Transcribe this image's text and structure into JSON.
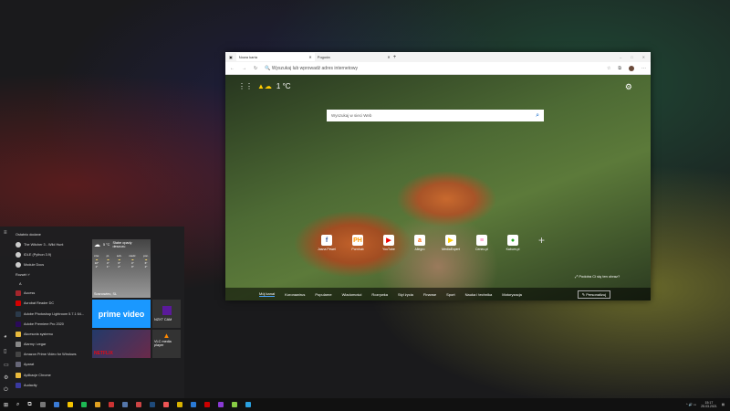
{
  "browser": {
    "tabs": [
      {
        "label": "Nowa karta",
        "active": true
      },
      {
        "label": "Pogoda",
        "active": false
      }
    ],
    "address_placeholder": "Wyszukaj lub wprowadź adres internetowy",
    "weather_temp": "1 °C",
    "search_placeholder": "Wyszukaj w sieci Web",
    "quick_links": [
      {
        "label": "Jasna Pewel",
        "icon": "f",
        "color": "#3b5998"
      },
      {
        "label": "Pornhub",
        "icon": "PH",
        "color": "#f90"
      },
      {
        "label": "YouTube",
        "icon": "▶",
        "color": "#e00"
      },
      {
        "label": "Allegro",
        "icon": "a",
        "color": "#f60"
      },
      {
        "label": "MediaExpert",
        "icon": "▶",
        "color": "#fc0"
      },
      {
        "label": "Ceneo.pl",
        "icon": "≡",
        "color": "#f6a"
      },
      {
        "label": "Kabum.pl",
        "icon": "●",
        "color": "#2a2"
      }
    ],
    "like_image": "Podoba Ci się ten obraz?",
    "nav": [
      "Mój kanał",
      "Koronawirus",
      "Popularne",
      "Wiadomości",
      "Rozrywka",
      "Styl życia",
      "Finanse",
      "Sport",
      "Nauka i technika",
      "Motoryzacja"
    ],
    "personalize": "Personalizuj"
  },
  "start_menu": {
    "recent_header": "Ostatnio dodane",
    "recent": [
      "The Witcher 3 - Wild Hunt",
      "IDLE (Python 3.9)",
      "Module Docs"
    ],
    "expand": "Rozwiń ˅",
    "letter": "A",
    "apps": [
      {
        "label": "Access",
        "color": "#a4262c"
      },
      {
        "label": "Acrobat Reader DC",
        "color": "#d40000"
      },
      {
        "label": "Adobe Photoshop Lightroom 5.7.1 64...",
        "color": "#2b3a4a"
      },
      {
        "label": "Adobe Premiere Pro 2020",
        "color": "#2a0a5a"
      },
      {
        "label": "Akcesoria systemu",
        "color": "#e8b93c"
      },
      {
        "label": "Alarmy i zegar",
        "color": "#888"
      },
      {
        "label": "Amazon Prime Video for Windows",
        "color": "#444"
      },
      {
        "label": "Aparat",
        "color": "#667"
      },
      {
        "label": "Aplikacje Chrome",
        "color": "#e8b93c"
      },
      {
        "label": "Audacity",
        "color": "#3a3aa0"
      }
    ],
    "weather_tile": {
      "temp": "5 °C",
      "desc": "Słabe opady deszczu",
      "days": [
        "czw.",
        "pt.",
        "sob.",
        "niedz.",
        "pon."
      ],
      "highs": [
        "10°",
        "4°",
        "6°",
        "4°",
        "6°"
      ],
      "lows": [
        "1°",
        "1°",
        "2°",
        "0°",
        "2°"
      ],
      "location": "Sosnowiec, SL"
    },
    "tiles": {
      "prime": "prime video",
      "nzxt": "NZXT CAM",
      "netflix": "NETFLIX",
      "vlc": "VLC media player"
    }
  },
  "taskbar": {
    "time": "15:17",
    "date": "25.03.2021"
  }
}
